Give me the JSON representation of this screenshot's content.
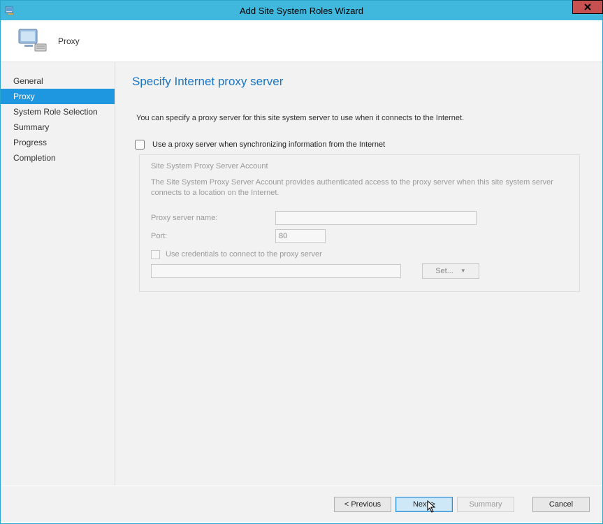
{
  "window": {
    "title": "Add Site System Roles Wizard"
  },
  "header": {
    "step_name": "Proxy"
  },
  "sidebar": {
    "items": [
      {
        "label": "General"
      },
      {
        "label": "Proxy"
      },
      {
        "label": "System Role Selection"
      },
      {
        "label": "Summary"
      },
      {
        "label": "Progress"
      },
      {
        "label": "Completion"
      }
    ]
  },
  "content": {
    "heading": "Specify Internet proxy server",
    "intro": "You can specify a proxy server for this site system server to use when it connects to the Internet.",
    "use_proxy_label": "Use a proxy server when synchronizing information from the Internet",
    "fieldset": {
      "legend": "Site System Proxy Server Account",
      "desc": "The Site System Proxy Server Account provides authenticated access to the proxy server when this site system server connects to a location on the Internet.",
      "proxy_name_label": "Proxy server name:",
      "proxy_name_value": "",
      "port_label": "Port:",
      "port_value": "80",
      "use_creds_label": "Use credentials to connect to the proxy server",
      "cred_value": "",
      "set_label": "Set..."
    }
  },
  "footer": {
    "previous": "< Previous",
    "next": "Next >",
    "summary": "Summary",
    "cancel": "Cancel"
  }
}
